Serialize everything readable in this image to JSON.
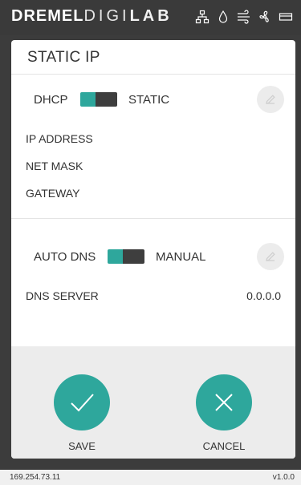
{
  "header": {
    "brand_part1": "DREMEL",
    "brand_part2": "DIGI",
    "brand_part3": "LAB",
    "icons": [
      "network-icon",
      "drop-icon",
      "airflow-icon",
      "fan-icon",
      "filament-icon"
    ]
  },
  "dialog": {
    "title": "STATIC IP",
    "ip_mode": {
      "left_label": "DHCP",
      "right_label": "STATIC"
    },
    "fields": [
      {
        "label": "IP ADDRESS",
        "value": ""
      },
      {
        "label": "NET MASK",
        "value": ""
      },
      {
        "label": "GATEWAY",
        "value": ""
      }
    ],
    "dns_mode": {
      "left_label": "AUTO DNS",
      "right_label": "MANUAL"
    },
    "dns_server": {
      "label": "DNS SERVER",
      "value": "0.0.0.0"
    },
    "save_label": "SAVE",
    "cancel_label": "CANCEL"
  },
  "status": {
    "ip": "169.254.73.11",
    "version": "v1.0.0"
  },
  "colors": {
    "accent": "#2ea79c",
    "header_bg": "#3a3a3a",
    "card_bg": "#ffffff",
    "footer_bg": "#ececec"
  }
}
